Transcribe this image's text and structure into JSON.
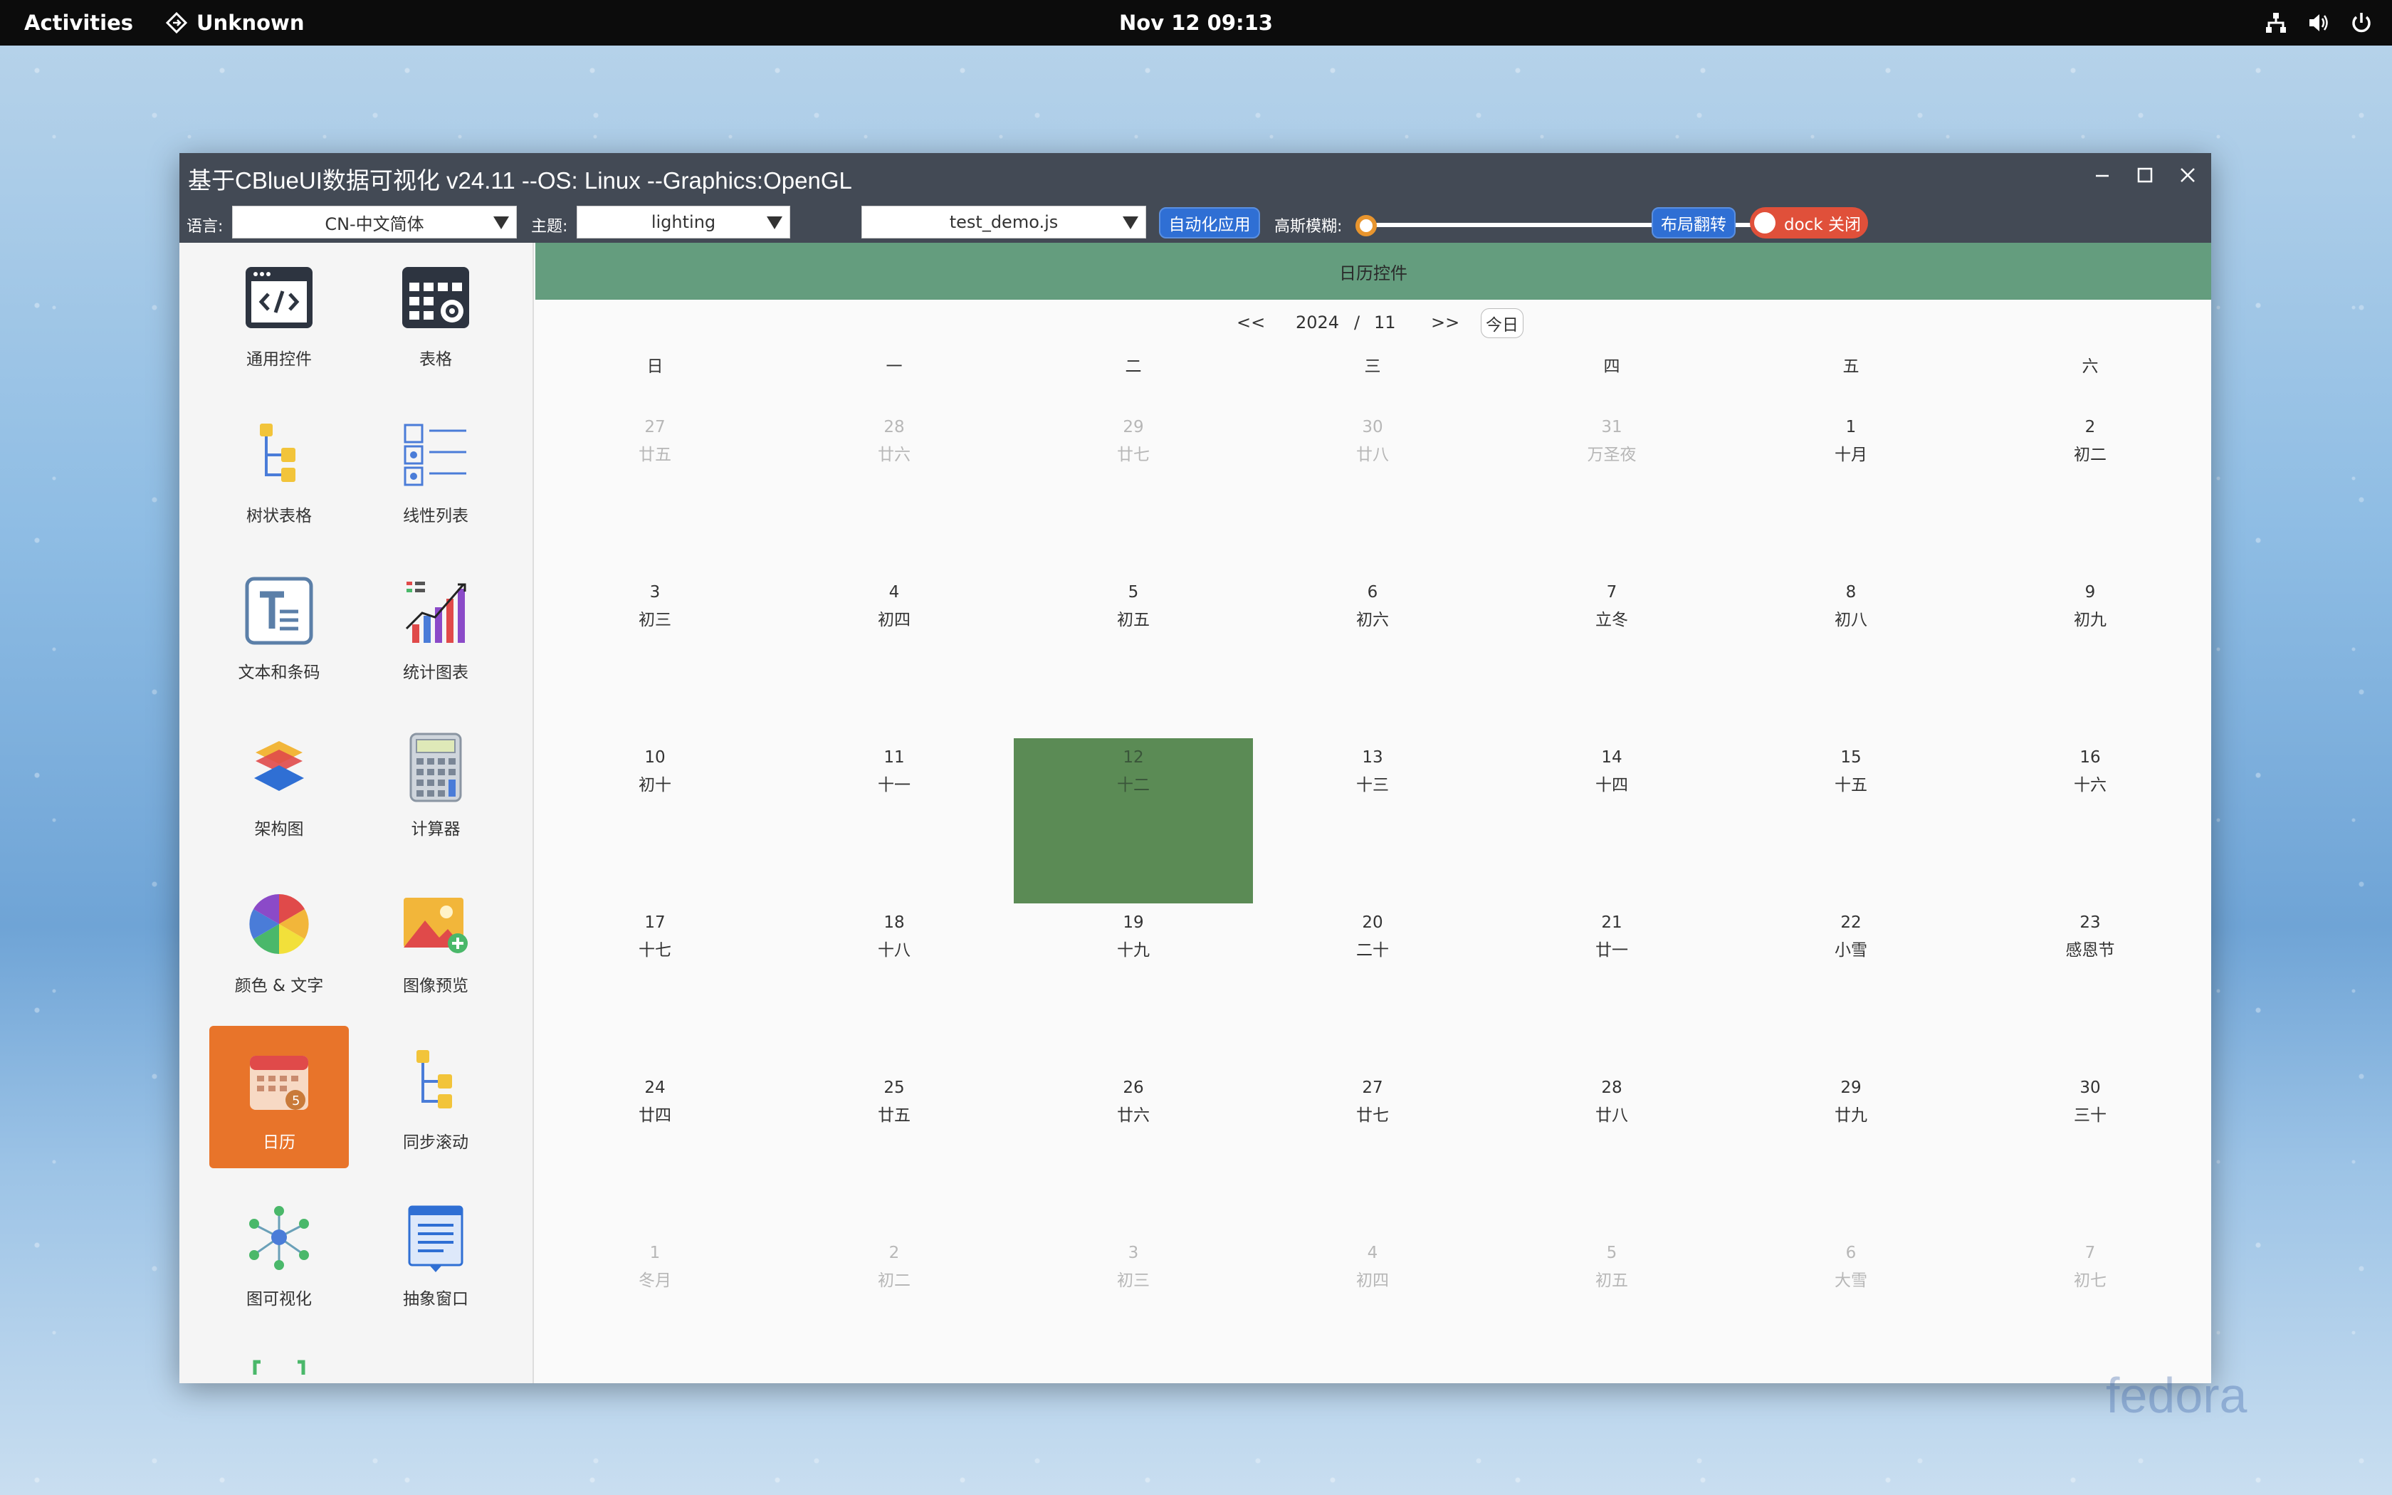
{
  "topbar": {
    "activities": "Activities",
    "app_name": "Unknown",
    "clock": "Nov 12  09:13"
  },
  "window": {
    "title": "基于CBlueUI数据可视化  v24.11  --OS: Linux  --Graphics:OpenGL",
    "toolbar": {
      "language_label": "语言:",
      "language_value": "CN-中文简体",
      "theme_label": "主题:",
      "theme_value": "lighting",
      "script_value": "test_demo.js",
      "auto_apply_label": "自动化应用",
      "blur_label": "高斯模糊:",
      "blur_value": 0,
      "flip_layout_label": "布局翻转",
      "dock_label": "dock 关闭"
    }
  },
  "sidebar": {
    "items": [
      {
        "label": "通用控件",
        "icon": "code-window-icon"
      },
      {
        "label": "表格",
        "icon": "table-settings-icon"
      },
      {
        "label": "树状表格",
        "icon": "tree-table-icon"
      },
      {
        "label": "线性列表",
        "icon": "linear-list-icon"
      },
      {
        "label": "文本和条码",
        "icon": "text-barcode-icon"
      },
      {
        "label": "统计图表",
        "icon": "statistics-chart-icon"
      },
      {
        "label": "架构图",
        "icon": "architecture-icon"
      },
      {
        "label": "计算器",
        "icon": "calculator-icon"
      },
      {
        "label": "颜色 & 文字",
        "icon": "color-wheel-icon"
      },
      {
        "label": "图像预览",
        "icon": "image-preview-icon"
      },
      {
        "label": "日历",
        "icon": "calendar-icon",
        "active": true
      },
      {
        "label": "同步滚动",
        "icon": "sync-scroll-icon"
      },
      {
        "label": "图可视化",
        "icon": "graph-network-icon"
      },
      {
        "label": "抽象窗口",
        "icon": "abstract-window-icon"
      }
    ]
  },
  "calendar": {
    "header": "日历控件",
    "prev": "<<",
    "next": ">>",
    "year": "2024",
    "sep": "/",
    "month": "11",
    "today_btn": "今日",
    "weekdays": [
      "日",
      "一",
      "二",
      "三",
      "四",
      "五",
      "六"
    ],
    "weeks": [
      [
        [
          "27",
          "廿五",
          true
        ],
        [
          "28",
          "廿六",
          true
        ],
        [
          "29",
          "廿七",
          true
        ],
        [
          "30",
          "廿八",
          true
        ],
        [
          "31",
          "万圣夜",
          true
        ],
        [
          "1",
          "十月",
          false
        ],
        [
          "2",
          "初二",
          false
        ]
      ],
      [
        [
          "3",
          "初三",
          false
        ],
        [
          "4",
          "初四",
          false
        ],
        [
          "5",
          "初五",
          false
        ],
        [
          "6",
          "初六",
          false
        ],
        [
          "7",
          "立冬",
          false
        ],
        [
          "8",
          "初八",
          false
        ],
        [
          "9",
          "初九",
          false
        ]
      ],
      [
        [
          "10",
          "初十",
          false
        ],
        [
          "11",
          "十一",
          false
        ],
        [
          "12",
          "十二",
          false
        ],
        [
          "13",
          "十三",
          false
        ],
        [
          "14",
          "十四",
          false
        ],
        [
          "15",
          "十五",
          false
        ],
        [
          "16",
          "十六",
          false
        ]
      ],
      [
        [
          "17",
          "十七",
          false
        ],
        [
          "18",
          "十八",
          false
        ],
        [
          "19",
          "十九",
          false
        ],
        [
          "20",
          "二十",
          false
        ],
        [
          "21",
          "廿一",
          false
        ],
        [
          "22",
          "小雪",
          false
        ],
        [
          "23",
          "感恩节",
          false
        ]
      ],
      [
        [
          "24",
          "廿四",
          false
        ],
        [
          "25",
          "廿五",
          false
        ],
        [
          "26",
          "廿六",
          false
        ],
        [
          "27",
          "廿七",
          false
        ],
        [
          "28",
          "廿八",
          false
        ],
        [
          "29",
          "廿九",
          false
        ],
        [
          "30",
          "三十",
          false
        ]
      ],
      [
        [
          "1",
          "冬月",
          true
        ],
        [
          "2",
          "初二",
          true
        ],
        [
          "3",
          "初三",
          true
        ],
        [
          "4",
          "初四",
          true
        ],
        [
          "5",
          "初五",
          true
        ],
        [
          "6",
          "大雪",
          true
        ],
        [
          "7",
          "初七",
          true
        ]
      ]
    ],
    "selected_day": "12"
  },
  "watermark": "fedora",
  "colors": {
    "header_green": "#649d7e",
    "selected_green": "#5b8b55",
    "active_nav_orange": "#e8742a",
    "titlebar": "#434a55"
  }
}
